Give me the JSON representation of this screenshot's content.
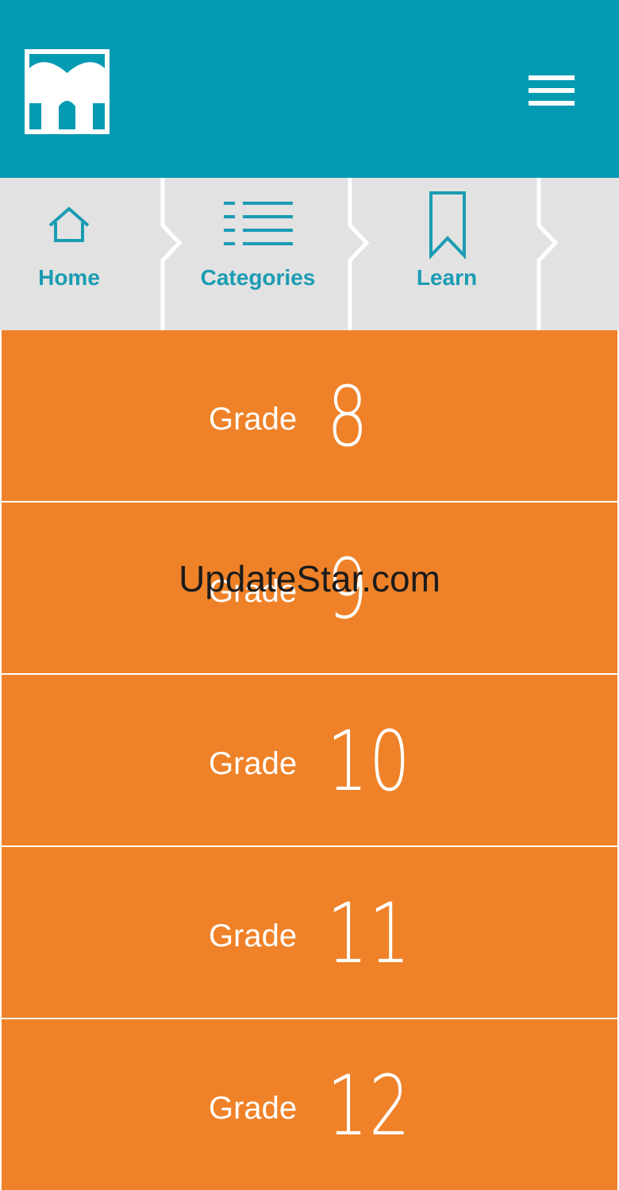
{
  "colors": {
    "header_bg": "#029bb2",
    "accent": "#1a9cb3",
    "nav_bg": "#e2e2e2",
    "grade_bg": "#ef8228",
    "grade_text": "#ffffff"
  },
  "header": {
    "logo_icon": "app-logo",
    "menu_icon": "hamburger-menu-icon"
  },
  "breadcrumb": {
    "items": [
      {
        "label": "Home",
        "icon": "home-icon"
      },
      {
        "label": "Categories",
        "icon": "list-icon"
      },
      {
        "label": "Learn",
        "icon": "bookmark-icon"
      }
    ]
  },
  "grades": [
    {
      "word": "Grade",
      "number": "8"
    },
    {
      "word": "Grade",
      "number": "9"
    },
    {
      "word": "Grade",
      "number": "10"
    },
    {
      "word": "Grade",
      "number": "11"
    },
    {
      "word": "Grade",
      "number": "12"
    }
  ],
  "watermark": "UpdateStar.com"
}
